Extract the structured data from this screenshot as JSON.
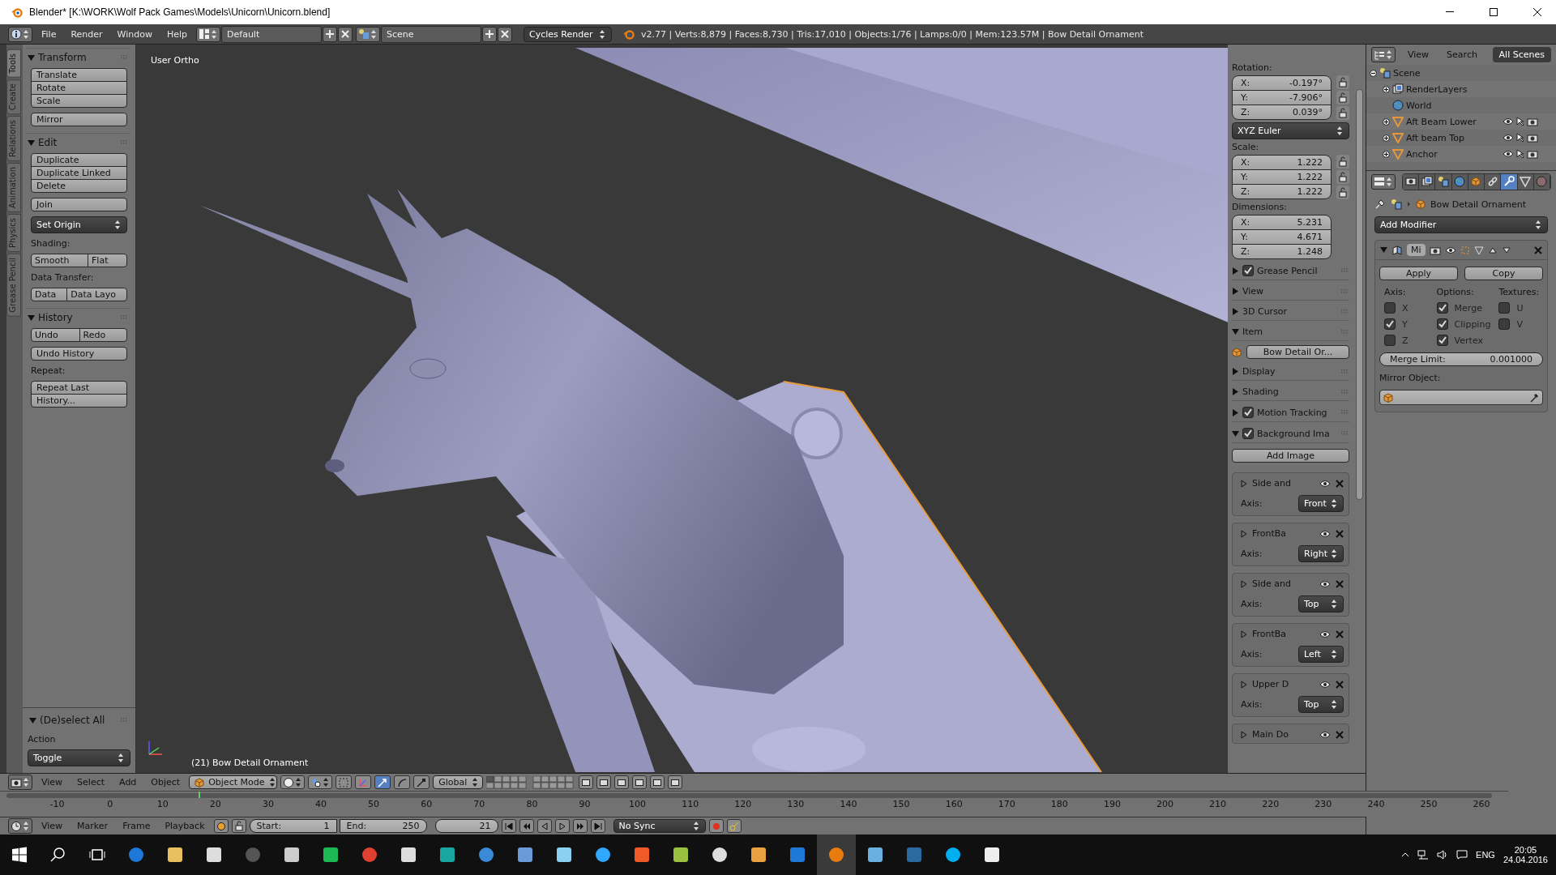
{
  "window": {
    "title": "Blender* [K:\\WORK\\Wolf Pack Games\\Models\\Unicorn\\Unicorn.blend]"
  },
  "info_header": {
    "menus": [
      "File",
      "Render",
      "Window",
      "Help"
    ],
    "screen_layout": "Default",
    "scene": "Scene",
    "render_engine": "Cycles Render",
    "stats": "v2.77 | Verts:8,879 | Faces:8,730 | Tris:17,010 | Objects:1/76 | Lamps:0/0 | Mem:123.57M | Bow Detail Ornament"
  },
  "tool_tabs": [
    {
      "label": "Tools",
      "selected": true
    },
    {
      "label": "Create",
      "selected": false
    },
    {
      "label": "Relations",
      "selected": false
    },
    {
      "label": "Animation",
      "selected": false
    },
    {
      "label": "Physics",
      "selected": false
    },
    {
      "label": "Grease Pencil",
      "selected": false
    }
  ],
  "tool_panels": [
    {
      "title": "Transform",
      "expanded": true,
      "rows": [
        {
          "kind": "stack",
          "buttons": [
            "Translate",
            "Rotate",
            "Scale"
          ]
        },
        {
          "kind": "stack",
          "buttons": [
            "Mirror"
          ]
        }
      ]
    },
    {
      "title": "Edit",
      "expanded": true,
      "rows": [
        {
          "kind": "stack",
          "buttons": [
            "Duplicate",
            "Duplicate Linked",
            "Delete"
          ]
        },
        {
          "kind": "stack",
          "buttons": [
            "Join"
          ]
        },
        {
          "kind": "dropdown",
          "value": "Set Origin"
        },
        {
          "kind": "label",
          "text": "Shading:"
        },
        {
          "kind": "split",
          "buttons": [
            "Smooth",
            "Flat"
          ]
        },
        {
          "kind": "label",
          "text": "Data Transfer:"
        },
        {
          "kind": "split",
          "buttons": [
            "Data",
            "Data Layo"
          ]
        }
      ]
    },
    {
      "title": "History",
      "expanded": true,
      "rows": [
        {
          "kind": "split",
          "buttons": [
            "Undo",
            "Redo"
          ]
        },
        {
          "kind": "stack",
          "buttons": [
            "Undo History"
          ]
        },
        {
          "kind": "label",
          "text": "Repeat:"
        },
        {
          "kind": "stack",
          "buttons": [
            "Repeat Last",
            "History..."
          ]
        }
      ]
    }
  ],
  "operator_panel": {
    "title": "(De)select All",
    "expanded": true,
    "label": "Action",
    "value": "Toggle"
  },
  "viewport": {
    "view_name": "User Ortho",
    "object_label": "(21) Bow Detail Ornament"
  },
  "n_panel": [
    {
      "kind": "label",
      "text": "Rotation:"
    },
    {
      "kind": "vector",
      "locks": true,
      "fields": [
        {
          "axis": "X:",
          "value": "-0.197°"
        },
        {
          "axis": "Y:",
          "value": "-7.906°"
        },
        {
          "axis": "Z:",
          "value": "0.039°"
        }
      ]
    },
    {
      "kind": "dropdown",
      "value": "XYZ Euler"
    },
    {
      "kind": "label",
      "text": "Scale:"
    },
    {
      "kind": "vector",
      "locks": true,
      "fields": [
        {
          "axis": "X:",
          "value": "1.222"
        },
        {
          "axis": "Y:",
          "value": "1.222"
        },
        {
          "axis": "Z:",
          "value": "1.222"
        }
      ]
    },
    {
      "kind": "label",
      "text": "Dimensions:"
    },
    {
      "kind": "vector",
      "fields": [
        {
          "axis": "X:",
          "value": "5.231"
        },
        {
          "axis": "Y:",
          "value": "4.671"
        },
        {
          "axis": "Z:",
          "value": "1.248"
        }
      ]
    },
    {
      "kind": "panel",
      "title": "Grease Pencil",
      "expanded": false,
      "checked": true
    },
    {
      "kind": "panel",
      "title": "View",
      "expanded": false
    },
    {
      "kind": "panel",
      "title": "3D Cursor",
      "expanded": false
    },
    {
      "kind": "panel",
      "title": "Item",
      "expanded": true
    },
    {
      "kind": "object",
      "value": "Bow Detail Or..."
    },
    {
      "kind": "panel",
      "title": "Display",
      "expanded": false
    },
    {
      "kind": "panel",
      "title": "Shading",
      "expanded": false
    },
    {
      "kind": "panel",
      "title": "Motion Tracking",
      "expanded": false,
      "checked": true
    },
    {
      "kind": "panel",
      "title": "Background Ima",
      "expanded": true,
      "checked": true
    },
    {
      "kind": "button",
      "text": "Add Image"
    },
    {
      "kind": "bg_image",
      "name": "Side and",
      "axis_label": "Axis:",
      "axis": "Front"
    },
    {
      "kind": "bg_image",
      "name": "FrontBa",
      "axis_label": "Axis:",
      "axis": "Right"
    },
    {
      "kind": "bg_image",
      "name": "Side and",
      "axis_label": "Axis:",
      "axis": "Top"
    },
    {
      "kind": "bg_image",
      "name": "FrontBa",
      "axis_label": "Axis:",
      "axis": "Left"
    },
    {
      "kind": "bg_image",
      "name": "Upper D",
      "axis_label": "Axis:",
      "axis": "Top"
    },
    {
      "kind": "bg_image",
      "name": "Main Do"
    }
  ],
  "outliner": {
    "menus": [
      "View",
      "Search"
    ],
    "filter": "All Scenes",
    "tree": [
      {
        "label": "Scene",
        "kind": "scene",
        "expanded": true,
        "children": [
          {
            "label": "RenderLayers",
            "kind": "render_layers",
            "expanded": false
          },
          {
            "label": "World",
            "kind": "world"
          },
          {
            "label": "Aft Beam Lower",
            "kind": "mesh",
            "expanded": false
          },
          {
            "label": "Aft beam Top",
            "kind": "mesh",
            "expanded": false
          },
          {
            "label": "Anchor",
            "kind": "mesh",
            "expanded": false
          }
        ]
      }
    ]
  },
  "properties": {
    "tabs": [
      {
        "kind": "render",
        "selected": false
      },
      {
        "kind": "render_layers",
        "selected": false
      },
      {
        "kind": "scene",
        "selected": false
      },
      {
        "kind": "world",
        "selected": false
      },
      {
        "kind": "object",
        "selected": false
      },
      {
        "kind": "constraints",
        "selected": false
      },
      {
        "kind": "modifiers",
        "selected": true
      },
      {
        "kind": "data",
        "selected": false
      },
      {
        "kind": "material",
        "selected": false
      }
    ],
    "breadcrumb": "Bow Detail Ornament",
    "add_modifier": "Add Modifier",
    "modifier": {
      "name": "Mi",
      "expanded": true,
      "buttons": [
        "Apply",
        "Copy"
      ],
      "columns": [
        {
          "title": "Axis:",
          "options": [
            {
              "label": "X",
              "checked": false
            },
            {
              "label": "Y",
              "checked": true
            },
            {
              "label": "Z",
              "checked": false
            }
          ]
        },
        {
          "title": "Options:",
          "options": [
            {
              "label": "Merge",
              "checked": true
            },
            {
              "label": "Clipping",
              "checked": true
            },
            {
              "label": "Vertex",
              "checked": true
            }
          ]
        },
        {
          "title": "Textures:",
          "options": [
            {
              "label": "U",
              "checked": false
            },
            {
              "label": "V",
              "checked": false
            }
          ]
        }
      ],
      "merge_limit": {
        "label": "Merge Limit:",
        "value": "0.001000"
      },
      "mirror_object_label": "Mirror Object:"
    }
  },
  "view3d_header": {
    "menus": [
      "View",
      "Select",
      "Add",
      "Object"
    ],
    "mode": "Object Mode",
    "orientation": "Global"
  },
  "timeline": {
    "ticks": [
      "-10",
      "0",
      "10",
      "20",
      "30",
      "40",
      "50",
      "60",
      "70",
      "80",
      "90",
      "100",
      "110",
      "120",
      "130",
      "140",
      "150",
      "160",
      "170",
      "180",
      "190",
      "200",
      "210",
      "220",
      "230",
      "240",
      "250",
      "260"
    ],
    "menus": [
      "View",
      "Marker",
      "Frame",
      "Playback"
    ],
    "start": {
      "label": "Start:",
      "value": "1"
    },
    "end": {
      "label": "End:",
      "value": "250"
    },
    "current_frame": "21",
    "sync": "No Sync"
  },
  "taskbar": {
    "language": "ENG",
    "time": "20:05",
    "date": "24.04.2016"
  }
}
